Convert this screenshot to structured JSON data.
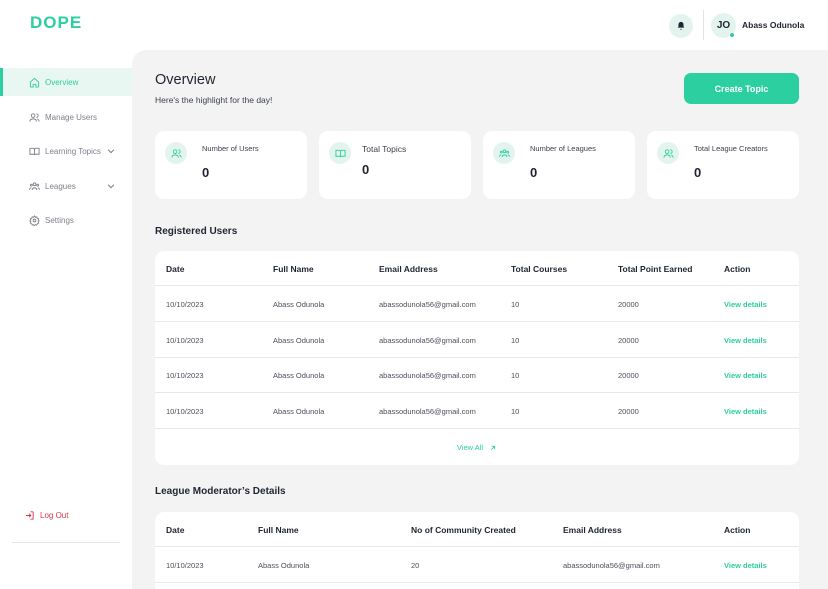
{
  "brand": {
    "logo": "DOPE",
    "accent": "#2ccf9f"
  },
  "header": {
    "avatar_initials": "JO",
    "user_name": "Abass Odunola",
    "bell_icon": "bell-icon"
  },
  "sidebar": {
    "items": [
      {
        "label": "Overview",
        "icon": "home-icon",
        "active": true
      },
      {
        "label": "Manage Users",
        "icon": "users-icon"
      },
      {
        "label": "Learning Topics",
        "icon": "book-icon",
        "has_chevron": true
      },
      {
        "label": "Leagues",
        "icon": "group-icon",
        "has_chevron": true
      },
      {
        "label": "Settings",
        "icon": "gear-icon"
      }
    ],
    "logout_label": "Log Out"
  },
  "page": {
    "title": "Overview",
    "subtitle": "Here's the highlight for the day!",
    "create_button": "Create Topic"
  },
  "stats": [
    {
      "label": "Number of Users",
      "value": "0",
      "icon": "users-icon"
    },
    {
      "label": "Total Topics",
      "value": "0",
      "icon": "book-icon"
    },
    {
      "label": "Number of Leagues",
      "value": "0",
      "icon": "group-icon"
    },
    {
      "label": "Total League Creators",
      "value": "0",
      "icon": "users-icon"
    }
  ],
  "registered_users": {
    "title": "Registered Users",
    "columns": [
      "Date",
      "Full Name",
      "Email Address",
      "Total Courses",
      "Total Point Earned",
      "Action"
    ],
    "rows": [
      [
        "10/10/2023",
        "Abass Odunola",
        "abassodunola56@gmail.com",
        "10",
        "20000",
        "View details"
      ],
      [
        "10/10/2023",
        "Abass Odunola",
        "abassodunola56@gmail.com",
        "10",
        "20000",
        "View details"
      ],
      [
        "10/10/2023",
        "Abass Odunola",
        "abassodunola56@gmail.com",
        "10",
        "20000",
        "View details"
      ],
      [
        "10/10/2023",
        "Abass Odunola",
        "abassodunola56@gmail.com",
        "10",
        "20000",
        "View details"
      ]
    ],
    "view_all": "View All"
  },
  "moderators": {
    "title": "League Moderator’s  Details",
    "columns": [
      "Date",
      "Full Name",
      "No of Community Created",
      "Email Address",
      "Action"
    ],
    "rows": [
      [
        "10/10/2023",
        "Abass Odunola",
        "20",
        "abassodunola56@gmail.com",
        "View details"
      ]
    ]
  }
}
